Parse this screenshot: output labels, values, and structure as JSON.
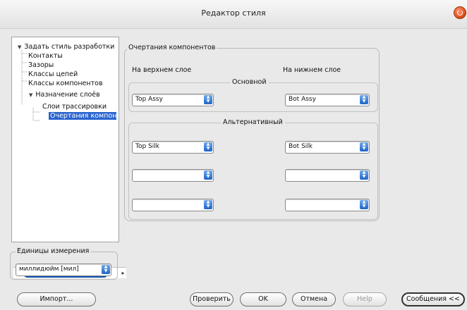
{
  "window": {
    "title": "Редактор стиля"
  },
  "tree": {
    "items": [
      {
        "label": "Задать стиль разработки",
        "level": 0,
        "expanded": true,
        "selected": false
      },
      {
        "label": "Контакты",
        "level": 1,
        "selected": false
      },
      {
        "label": "Зазоры",
        "level": 1,
        "selected": false
      },
      {
        "label": "Классы цепей",
        "level": 1,
        "selected": false
      },
      {
        "label": "Классы компонентов",
        "level": 1,
        "selected": false
      },
      {
        "label": "Назначение слоёв",
        "level": 1,
        "expanded": true,
        "selected": false
      },
      {
        "label": "Слои трассировки",
        "level": 2,
        "selected": false
      },
      {
        "label": "Очертания компонентов",
        "level": 2,
        "selected": true
      }
    ]
  },
  "units": {
    "group_title": "Единицы измерения",
    "selected": "миллидюйм [мил]"
  },
  "outline": {
    "group_title": "Очертания компонентов",
    "top_label": "На верхнем слое",
    "bottom_label": "На нижнем слое",
    "primary": {
      "title": "Основной",
      "top_value": "Top Assy",
      "bottom_value": "Bot Assy"
    },
    "alternative": {
      "title": "Альтернативный",
      "rows": [
        {
          "top": "Top Silk",
          "bottom": "Bot Silk"
        },
        {
          "top": "",
          "bottom": ""
        },
        {
          "top": "",
          "bottom": ""
        }
      ]
    }
  },
  "buttons": {
    "import": "Импорт...",
    "check": "Проверить",
    "ok": "OK",
    "cancel": "Отмена",
    "help": "Help",
    "messages": "Сообщения <<"
  },
  "colors": {
    "accent": "#2a64cf",
    "window_bg": "#e9e9e9",
    "close_button": "#e2501d"
  }
}
